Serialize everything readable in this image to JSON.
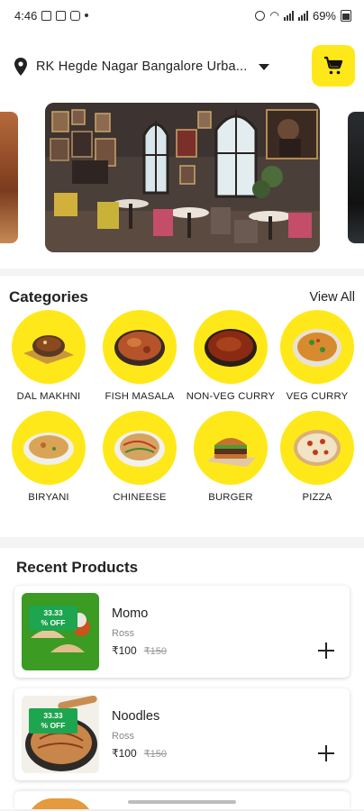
{
  "status_bar": {
    "time": "4:46",
    "battery": "69%"
  },
  "location": {
    "text": "RK Hegde Nagar Bangalore Urba..."
  },
  "icons": {
    "location": "map-pin-icon",
    "dropdown": "caret-down-icon",
    "cart": "shopping-cart-icon",
    "add": "plus-icon"
  },
  "colors": {
    "accent": "#ffe81a",
    "badge": "#1ea54f",
    "text": "#222222"
  },
  "categories": {
    "title": "Categories",
    "view_all": "View All",
    "items": [
      {
        "label": "DAL MAKHNI"
      },
      {
        "label": "FISH MASALA"
      },
      {
        "label": "NON-VEG CURRY"
      },
      {
        "label": "VEG CURRY"
      },
      {
        "label": "BIRYANI"
      },
      {
        "label": "CHINEESE"
      },
      {
        "label": "BURGER"
      },
      {
        "label": "PIZZA"
      }
    ]
  },
  "recent": {
    "title": "Recent Products",
    "products": [
      {
        "name": "Momo",
        "shop": "Ross",
        "price": "₹100",
        "old_price": "₹150",
        "badge": "33.33\n% OFF"
      },
      {
        "name": "Noodles",
        "shop": "Ross",
        "price": "₹100",
        "old_price": "₹150",
        "badge": "33.33\n% OFF"
      }
    ]
  }
}
